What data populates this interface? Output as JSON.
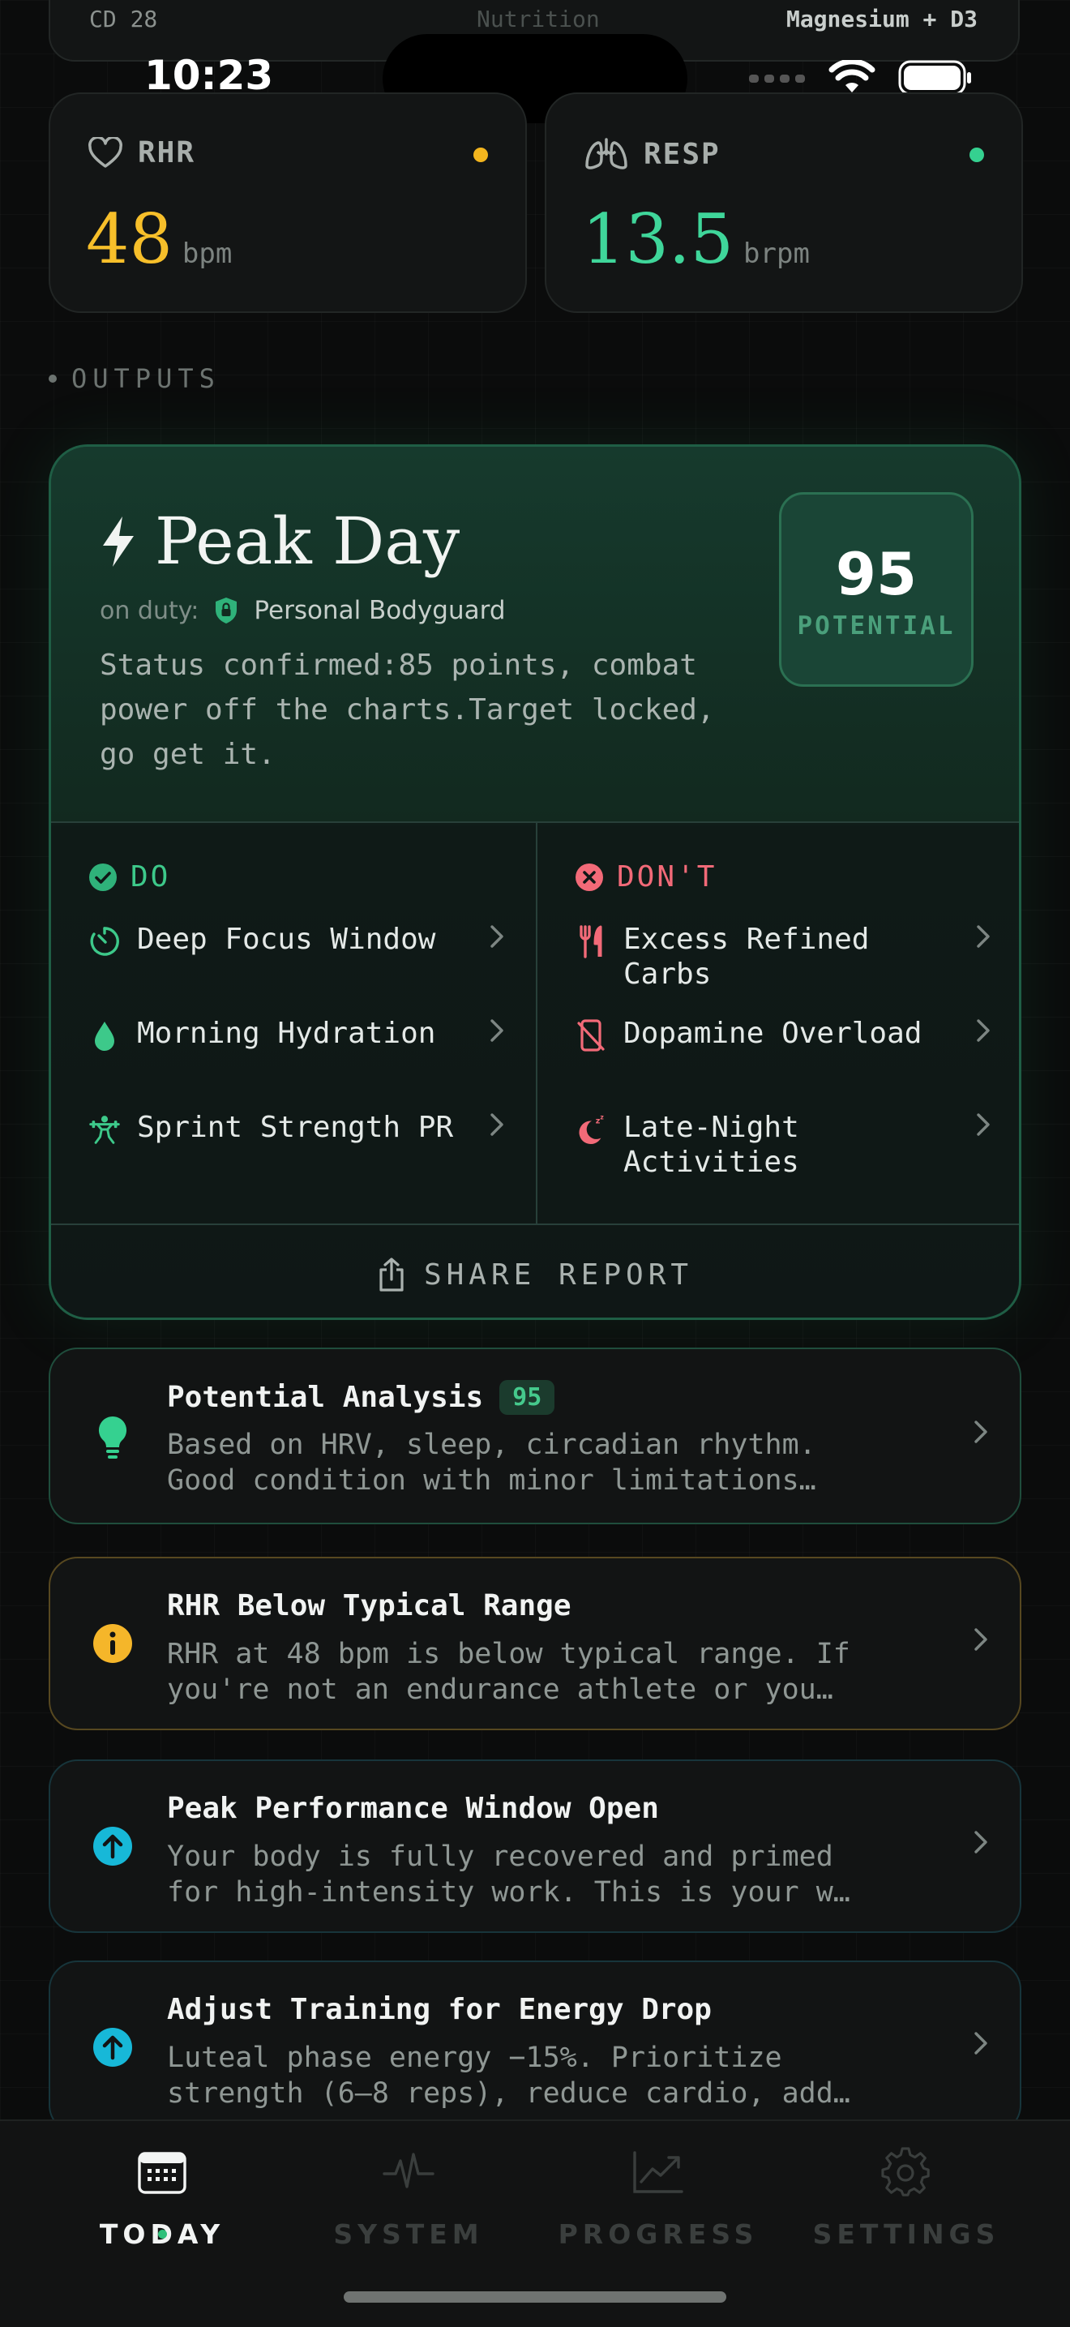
{
  "top_card": {
    "left": "CD 28",
    "center": "Nutrition",
    "right": "Magnesium + D3"
  },
  "status_bar": {
    "time": "10:23"
  },
  "metrics": [
    {
      "label": "RHR",
      "value": "48",
      "unit": "bpm",
      "color": "#f7bf2a",
      "dot_color": "#f3b51e"
    },
    {
      "label": "RESP",
      "value": "13.5",
      "unit": "brpm",
      "color": "#3fd69a",
      "dot_color": "#35d190"
    }
  ],
  "section_label": "OUTPUTS",
  "peak": {
    "title": "Peak Day",
    "duty_label": "on duty:",
    "duty_value": "Personal Bodyguard",
    "description": "Status confirmed:85 points, combat power off the charts.Target locked, go get it.",
    "score": "95",
    "score_label": "POTENTIAL",
    "do_label": "DO",
    "dont_label": "DON'T",
    "do_items": [
      "Deep Focus Window",
      "Morning Hydration",
      "Sprint Strength PR"
    ],
    "dont_items": [
      "Excess Refined Carbs",
      "Dopamine Overload",
      "Late-Night Activities"
    ],
    "share_label": "SHARE REPORT"
  },
  "insights": [
    {
      "title": "Potential Analysis",
      "badge": "95",
      "line1": "Based on HRV, sleep, circadian rhythm.",
      "line2": "Good condition with minor limitations…",
      "icon": "bulb-icon"
    },
    {
      "title": "RHR Below Typical Range",
      "line1": "RHR at 48 bpm is below typical range. If",
      "line2": "you're not an endurance athlete or you…",
      "icon": "info-icon"
    },
    {
      "title": "Peak Performance Window Open",
      "line1": "Your body is fully recovered and primed",
      "line2": "for high-intensity work. This is your w…",
      "icon": "arrow-up-icon"
    },
    {
      "title": "Adjust Training for Energy Drop",
      "line1": "Luteal phase energy −15%. Prioritize",
      "line2": "strength (6–8 reps), reduce cardio, add…",
      "icon": "arrow-up-icon"
    }
  ],
  "tabs": [
    "TODAY",
    "SYSTEM",
    "PROGRESS",
    "SETTINGS"
  ],
  "colors": {
    "accent": "#2fc07b",
    "dont": "#f26a78",
    "warning": "#f5b62a",
    "info": "#17b8d8"
  }
}
